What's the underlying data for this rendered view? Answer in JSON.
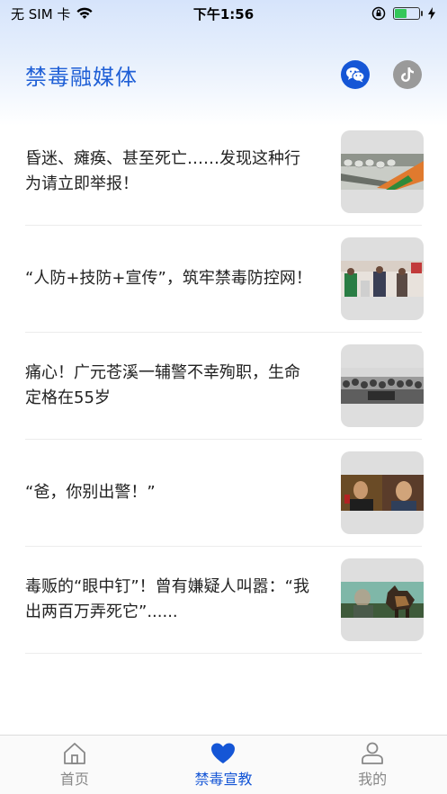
{
  "status_bar": {
    "carrier": "无 SIM 卡",
    "time": "下午1:56",
    "battery_level": 0.5
  },
  "header": {
    "title": "禁毒融媒体",
    "icons": [
      "wechat-icon",
      "tiktok-icon"
    ]
  },
  "feed": [
    {
      "title": "昏迷、瘫痪、甚至死亡……发现这种行为请立即举报！"
    },
    {
      "title": "“人防+技防+宣传”，筑牢禁毒防控网！"
    },
    {
      "title": "痛心！广元苍溪一辅警不幸殉职，生命定格在55岁"
    },
    {
      "title": "“爸，你别出警！”"
    },
    {
      "title": "毒贩的“眼中钉”！曾有嫌疑人叫嚣：“我出两百万弄死它”......"
    }
  ],
  "tabbar": {
    "tabs": [
      {
        "label": "首页",
        "icon": "home-icon",
        "active": false
      },
      {
        "label": "禁毒宣教",
        "icon": "heart-icon",
        "active": true
      },
      {
        "label": "我的",
        "icon": "user-icon",
        "active": false
      }
    ]
  },
  "colors": {
    "accent": "#1556d6",
    "title_blue": "#1f5fd6",
    "battery_green": "#34c759"
  }
}
